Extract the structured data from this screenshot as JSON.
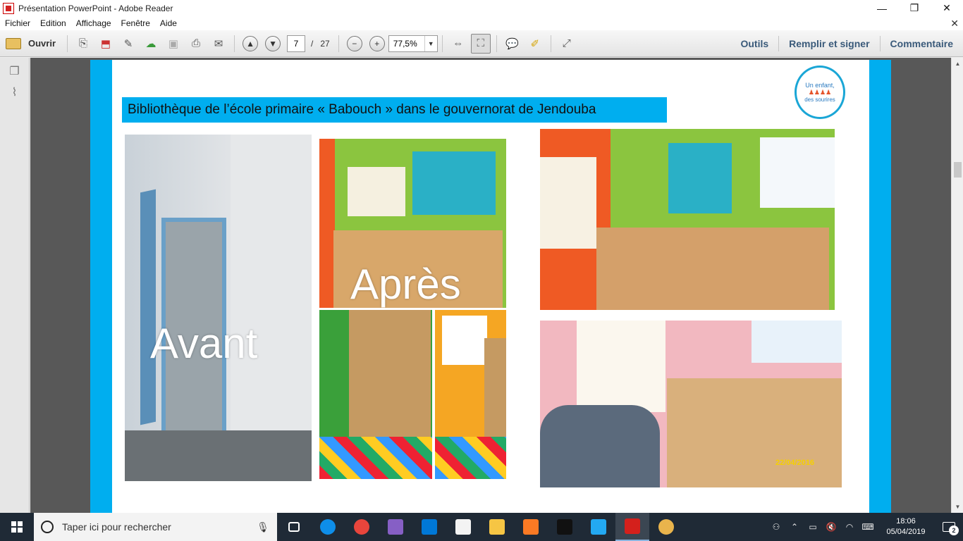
{
  "window": {
    "title": "Présentation PowerPoint - Adobe Reader",
    "minimize_glyph": "—",
    "restore_glyph": "❐",
    "close_glyph": "✕"
  },
  "menu": {
    "items": [
      "Fichier",
      "Edition",
      "Affichage",
      "Fenêtre",
      "Aide"
    ],
    "close_doc_glyph": "✕"
  },
  "toolbar": {
    "open_label": "Ouvrir",
    "page_current": "7",
    "page_separator": "/",
    "page_total": "27",
    "zoom_value": "77,5%",
    "right_links": [
      "Outils",
      "Remplir et signer",
      "Commentaire"
    ]
  },
  "slide": {
    "title": "Bibliothèque de l’école primaire « Babouch  » dans le gouvernorat de Jendouba",
    "logo_line1": "Un enfant,",
    "logo_line2": "des sourires",
    "photo_avant_label": "Avant",
    "photo_apres_label": "Après",
    "photo_date_stamp": "22/04/2016"
  },
  "taskbar": {
    "search_placeholder": "Taper ici pour rechercher",
    "clock_time": "18:06",
    "clock_date": "05/04/2019",
    "notification_count": "2",
    "apps": [
      {
        "name": "task-view-icon",
        "color": "#1f2a36"
      },
      {
        "name": "teamviewer-icon",
        "color": "#0e8ee9"
      },
      {
        "name": "chrome-icon",
        "color": "#e8453c"
      },
      {
        "name": "visual-studio-icon",
        "color": "#865fc5"
      },
      {
        "name": "edge-icon",
        "color": "#0078d7"
      },
      {
        "name": "store-icon",
        "color": "#f3f3f3"
      },
      {
        "name": "file-explorer-icon",
        "color": "#f6c544"
      },
      {
        "name": "xampp-icon",
        "color": "#fb7a24"
      },
      {
        "name": "terminal-icon",
        "color": "#111111"
      },
      {
        "name": "vscode-icon",
        "color": "#23a9f2"
      },
      {
        "name": "acrobat-icon",
        "color": "#d4201c"
      },
      {
        "name": "paint-icon",
        "color": "#e9b44c"
      }
    ]
  },
  "colors": {
    "slide_accent": "#00aeef",
    "doc_background": "#585858",
    "toolbar_link": "#3a5a7a"
  }
}
